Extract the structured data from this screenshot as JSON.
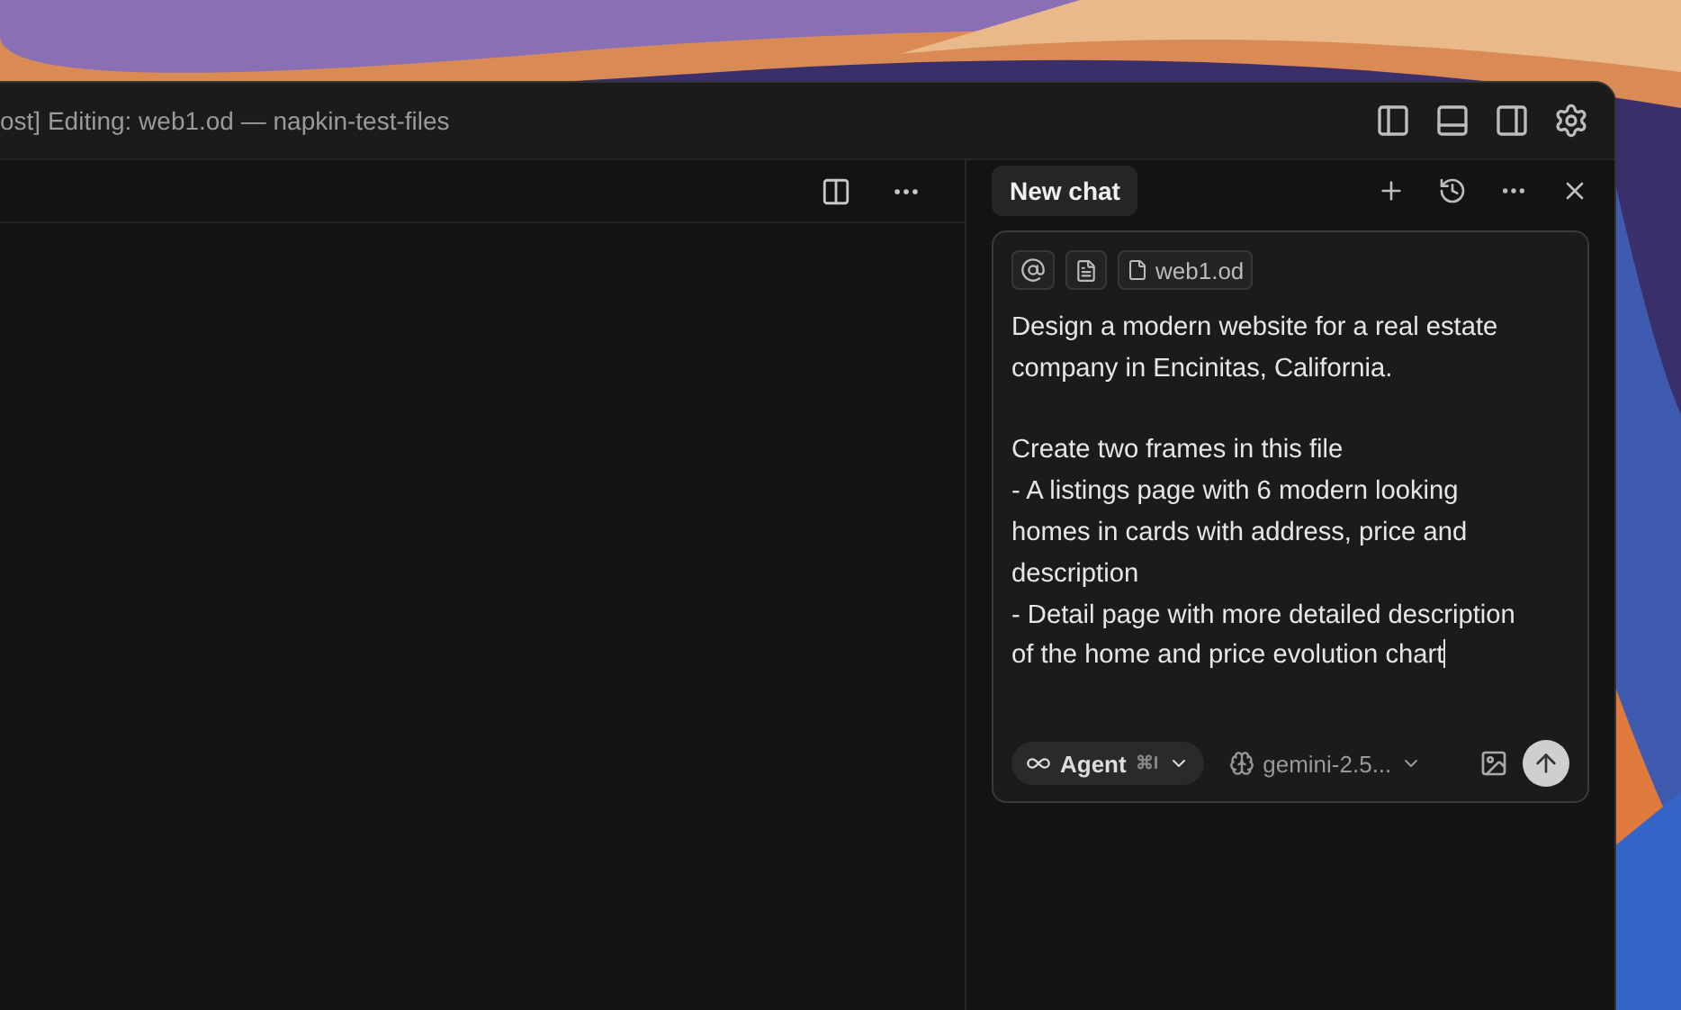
{
  "window": {
    "title": "ost] Editing: web1.od — napkin-test-files"
  },
  "chat": {
    "tab": "New chat",
    "context_chips": [
      {
        "kind": "mention"
      },
      {
        "kind": "file-icon"
      },
      {
        "kind": "file",
        "label": "web1.od"
      }
    ],
    "prompt": "Design a modern website for a real estate company in Encinitas, California.\n\nCreate two frames in this file\n- A listings page with 6 modern looking homes in cards with address, price and description\n- Detail page with more detailed description of the home and price evolution chart",
    "mode": {
      "label": "Agent",
      "shortcut": "⌘I"
    },
    "model": "gemini-2.5..."
  }
}
